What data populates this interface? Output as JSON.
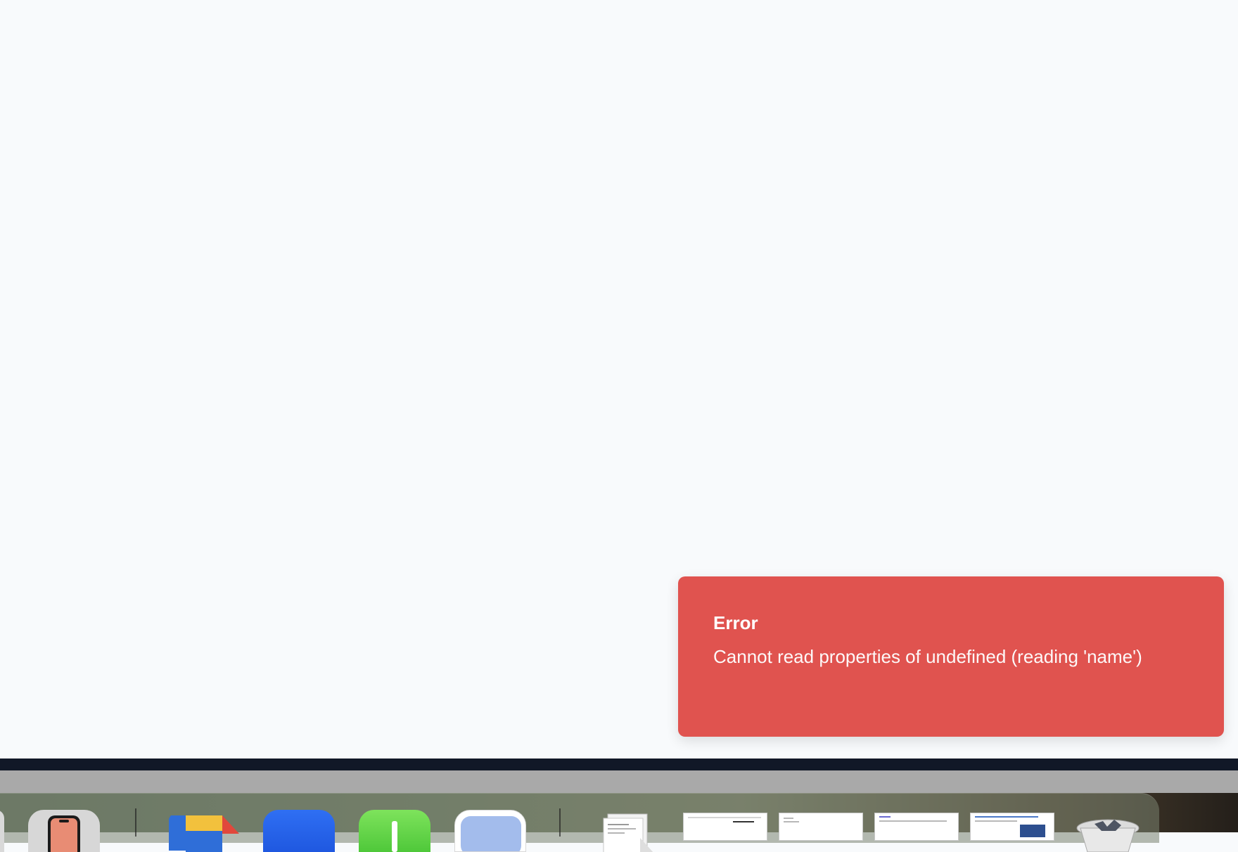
{
  "toast": {
    "title": "Error",
    "message": "Cannot read properties of undefined (reading 'name')",
    "color": "#e0534f"
  },
  "dock": {
    "items": [
      {
        "icon": "partial-app-icon"
      },
      {
        "icon": "iphone-mirroring-icon"
      },
      {
        "icon": "google-drive-icon"
      },
      {
        "icon": "blue-app-icon"
      },
      {
        "icon": "numbers-app-icon"
      },
      {
        "icon": "preview-app-icon"
      },
      {
        "icon": "document-stack-icon"
      },
      {
        "icon": "window-thumbnail-icon"
      },
      {
        "icon": "window-thumbnail-icon"
      },
      {
        "icon": "window-thumbnail-icon"
      },
      {
        "icon": "window-thumbnail-icon"
      },
      {
        "icon": "trash-icon"
      }
    ]
  }
}
